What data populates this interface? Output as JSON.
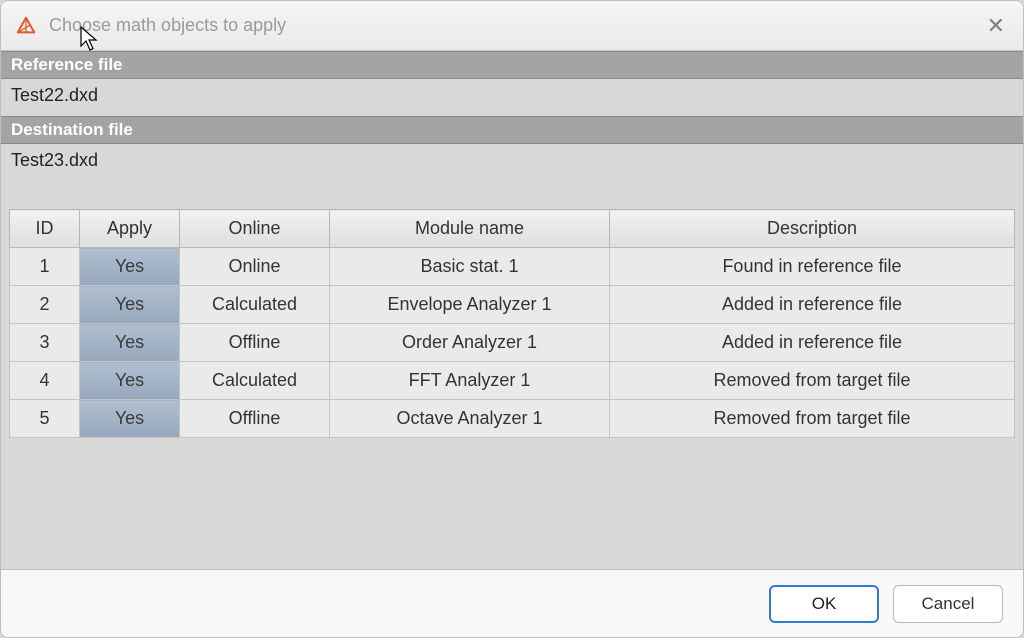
{
  "title": "Choose math objects to apply",
  "reference": {
    "label": "Reference file",
    "value": "Test22.dxd"
  },
  "destination": {
    "label": "Destination file",
    "value": "Test23.dxd"
  },
  "table": {
    "headers": {
      "id": "ID",
      "apply": "Apply",
      "online": "Online",
      "module": "Module name",
      "description": "Description"
    },
    "rows": [
      {
        "id": "1",
        "apply": "Yes",
        "online": "Online",
        "module": "Basic stat. 1",
        "description": "Found in reference file"
      },
      {
        "id": "2",
        "apply": "Yes",
        "online": "Calculated",
        "module": "Envelope Analyzer 1",
        "description": "Added in reference file"
      },
      {
        "id": "3",
        "apply": "Yes",
        "online": "Offline",
        "module": "Order Analyzer 1",
        "description": "Added in reference file"
      },
      {
        "id": "4",
        "apply": "Yes",
        "online": "Calculated",
        "module": "FFT Analyzer 1",
        "description": "Removed from target file"
      },
      {
        "id": "5",
        "apply": "Yes",
        "online": "Offline",
        "module": "Octave Analyzer 1",
        "description": "Removed from target file"
      }
    ]
  },
  "buttons": {
    "ok": "OK",
    "cancel": "Cancel"
  }
}
